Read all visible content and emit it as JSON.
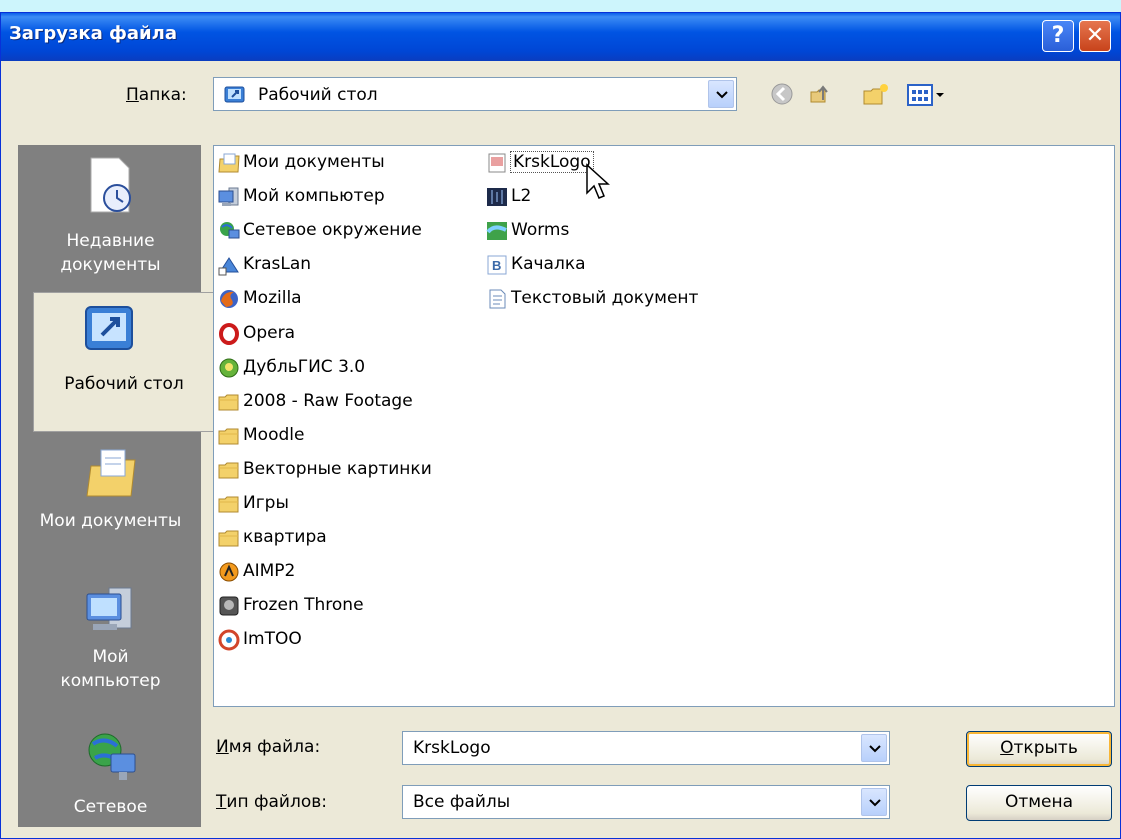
{
  "window": {
    "title": "Загрузка файла"
  },
  "folder_bar": {
    "label_prefix": "",
    "label_underlined": "П",
    "label_rest": "апка:",
    "current": "Рабочий стол"
  },
  "places": [
    {
      "line1": "Недавние",
      "line2": "документы",
      "icon": "recent-documents-icon"
    },
    {
      "line1": "Рабочий стол",
      "line2": "",
      "icon": "desktop-icon"
    },
    {
      "line1": "Мои документы",
      "line2": "",
      "icon": "my-documents-icon"
    },
    {
      "line1": "Мой",
      "line2": "компьютер",
      "icon": "my-computer-icon"
    },
    {
      "line1": "Сетевое",
      "line2": "",
      "icon": "network-icon"
    }
  ],
  "files_col1": [
    {
      "name": "Мои документы",
      "icon": "my-documents-icon"
    },
    {
      "name": "Мой компьютер",
      "icon": "computer-icon"
    },
    {
      "name": "Сетевое окружение",
      "icon": "network-icon"
    },
    {
      "name": "KrasLan",
      "icon": "network-shortcut-icon"
    },
    {
      "name": "Mozilla",
      "icon": "firefox-icon"
    },
    {
      "name": "Opera",
      "icon": "opera-icon"
    },
    {
      "name": "ДубльГИС 3.0",
      "icon": "dublgis-icon"
    },
    {
      "name": "2008 - Raw Footage",
      "icon": "folder-icon"
    },
    {
      "name": "Moodle",
      "icon": "folder-icon"
    },
    {
      "name": "Векторные картинки",
      "icon": "folder-icon"
    },
    {
      "name": "Игры",
      "icon": "folder-icon"
    },
    {
      "name": "квартира",
      "icon": "folder-icon"
    },
    {
      "name": "AIMP2",
      "icon": "aimp-icon"
    },
    {
      "name": "Frozen Throne",
      "icon": "game-icon"
    },
    {
      "name": "ImTOO",
      "icon": "imtoo-icon"
    }
  ],
  "files_col2": [
    {
      "name": "KrskLogo",
      "icon": "image-file-icon"
    },
    {
      "name": "L2",
      "icon": "l2-icon"
    },
    {
      "name": "Worms",
      "icon": "worms-icon"
    },
    {
      "name": "Качалка",
      "icon": "vkontakte-icon"
    },
    {
      "name": "Текстовый документ",
      "icon": "text-document-icon"
    }
  ],
  "filename": {
    "label_u": "И",
    "label_rest": "мя файла:",
    "value": "KrskLogo"
  },
  "filetype": {
    "label_u": "Т",
    "label_rest": "ип файлов:",
    "value": "Все файлы"
  },
  "buttons": {
    "open_u": "О",
    "open_rest": "ткрыть",
    "cancel": "Отмена"
  },
  "colors": {
    "titlebar": "#0054e3",
    "dialog_bg": "#ece9d8",
    "places_bg": "#808080"
  }
}
